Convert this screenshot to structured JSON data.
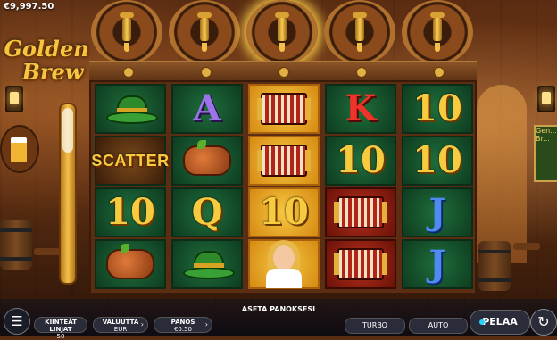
{
  "header": {
    "balance": "€9,997.50"
  },
  "logo": {
    "line1": "Golden",
    "line2": "Brew"
  },
  "right_sign": {
    "text": "Gen... Br..."
  },
  "reels": [
    {
      "highlight": false,
      "symbols": [
        "hat",
        "scatter",
        "10",
        "sausage"
      ]
    },
    {
      "highlight": false,
      "symbols": [
        "A",
        "sausage",
        "Q",
        "hat"
      ]
    },
    {
      "highlight": true,
      "symbols": [
        "accordion",
        "accordion",
        "10",
        "girl"
      ]
    },
    {
      "highlight": false,
      "symbols": [
        "K",
        "10",
        "accordion",
        "accordion"
      ]
    },
    {
      "highlight": false,
      "symbols": [
        "10",
        "10",
        "J",
        "J"
      ]
    }
  ],
  "symbol_labels": {
    "scatter": "SCATTER"
  },
  "toolbar": {
    "menu_icon": "☰",
    "fixed_lines_label": "KIINTEÄT LINJAT",
    "fixed_lines_value": "50",
    "currency_label": "VALUUTTA",
    "currency_value": "EUR",
    "bet_label": "PANOS",
    "bet_value": "€0.50",
    "set_bet_message": "ASETA PANOKSESI",
    "turbo_label": "TURBO",
    "auto_label": "AUTO",
    "play_label": "PELAA",
    "spin_icon": "↻"
  },
  "colors": {
    "gold": "#f7cb40",
    "reel_green": "#1f6e3c",
    "accent": "#28d2ff"
  }
}
